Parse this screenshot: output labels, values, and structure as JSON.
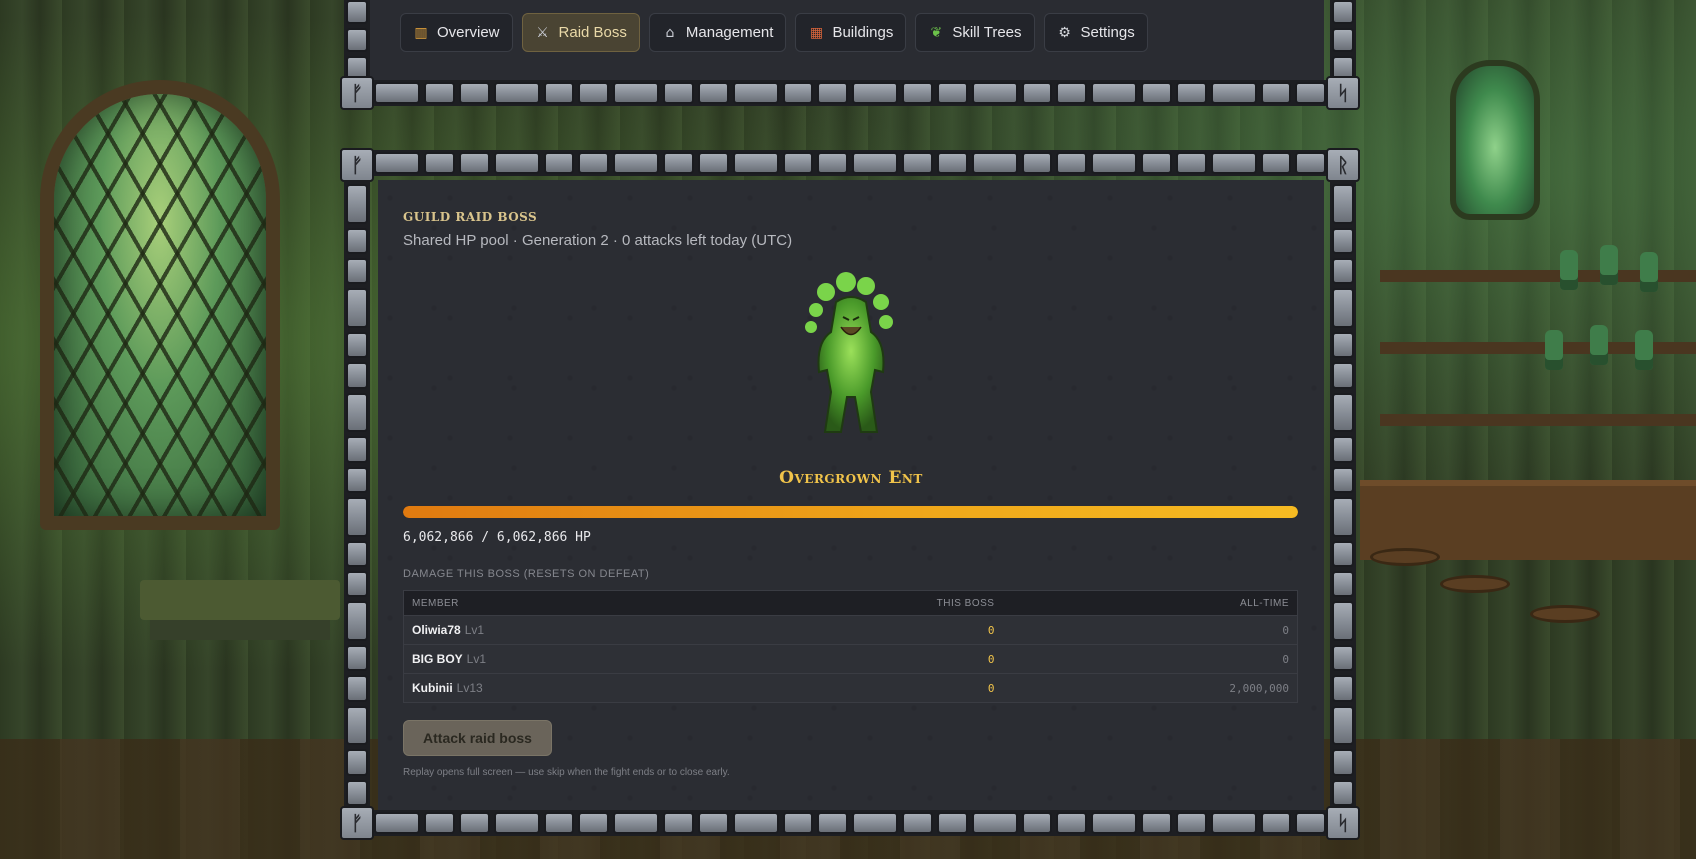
{
  "nav": {
    "tabs": [
      {
        "label": "Overview",
        "icon": "bar-chart-icon"
      },
      {
        "label": "Raid Boss",
        "icon": "crossed-swords-icon"
      },
      {
        "label": "Management",
        "icon": "bank-icon"
      },
      {
        "label": "Buildings",
        "icon": "building-icon"
      },
      {
        "label": "Skill Trees",
        "icon": "herb-icon"
      },
      {
        "label": "Settings",
        "icon": "gear-icon"
      }
    ],
    "active_tab": "Raid Boss"
  },
  "raid": {
    "eyebrow": "Guild Raid Boss",
    "subtitle": "Shared HP pool · Generation 2 · 0 attacks left today (UTC)",
    "boss_name": "Overgrown Ent",
    "hp_text": "6,062,866 / 6,062,866 HP",
    "hp_fraction": 1.0,
    "damage_label": "Damage this boss (resets on defeat)",
    "table": {
      "headers": [
        "Member",
        "This Boss",
        "All-Time"
      ],
      "rows": [
        {
          "name": "Oliwia78",
          "level": "Lv1",
          "this_boss": "0",
          "all_time": "0"
        },
        {
          "name": "BIG BOY",
          "level": "Lv1",
          "this_boss": "0",
          "all_time": "0"
        },
        {
          "name": "Kubinii",
          "level": "Lv13",
          "this_boss": "0",
          "all_time": "2,000,000"
        }
      ]
    },
    "attack_button": "Attack raid boss",
    "hint": "Replay opens full screen — use skip when the fight ends or to close early."
  },
  "colors": {
    "accent_gold": "#f0c34a",
    "hp_orange": "#f0a81a",
    "panel_bg": "#2b2d33",
    "active_tab_bg": "#4a4433"
  }
}
